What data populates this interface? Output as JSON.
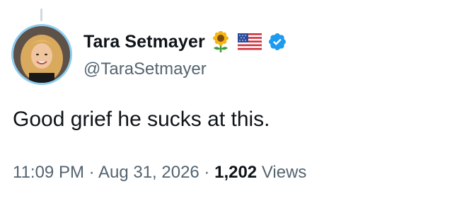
{
  "author": {
    "display_name": "Tara Setmayer",
    "handle": "@TaraSetmayer",
    "badges": [
      "sunflower-icon",
      "us-flag-icon",
      "verified-badge-icon"
    ],
    "verified_color": "#1d9bf0"
  },
  "tweet": {
    "text": "Good grief he sucks at this."
  },
  "meta": {
    "time": "11:09 PM",
    "separator1": " · ",
    "date": "Aug 31, 2026",
    "separator2": " · ",
    "views_count": "1,202",
    "views_label": " Views"
  }
}
